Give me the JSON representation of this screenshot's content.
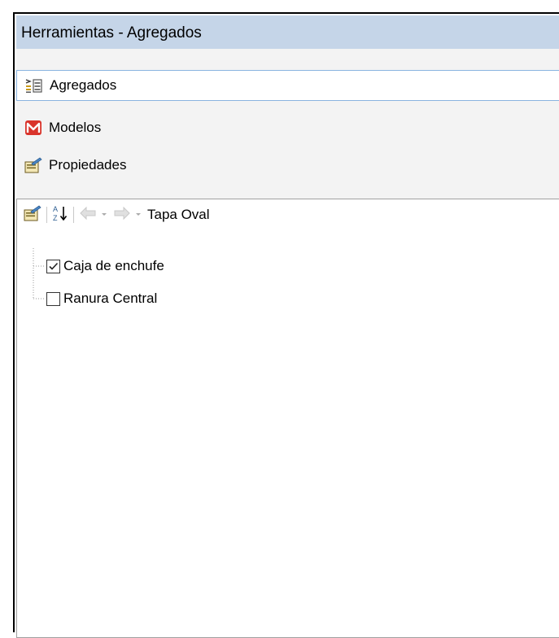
{
  "window": {
    "title": "Herramientas - Agregados"
  },
  "nav": {
    "items": [
      {
        "label": "Agregados",
        "icon": "aggregates-icon",
        "selected": true
      },
      {
        "label": "Modelos",
        "icon": "models-m-icon",
        "selected": false
      },
      {
        "label": "Propiedades",
        "icon": "properties-icon",
        "selected": false
      }
    ]
  },
  "toolbar": {
    "breadcrumb": "Tapa Oval",
    "icons": [
      "properties-icon",
      "sort-az-icon",
      "back-arrow-icon",
      "dropdown-arrow-icon",
      "forward-arrow-icon",
      "dropdown-arrow-icon"
    ]
  },
  "tree": {
    "items": [
      {
        "label": "Caja de enchufe",
        "checked": true
      },
      {
        "label": "Ranura Central",
        "checked": false
      }
    ]
  },
  "colors": {
    "titlebar_bg": "#c5d5e8",
    "selected_border": "#8ab4e0",
    "panel_bg": "#f3f3f3",
    "models_icon_red": "#d9342b"
  }
}
